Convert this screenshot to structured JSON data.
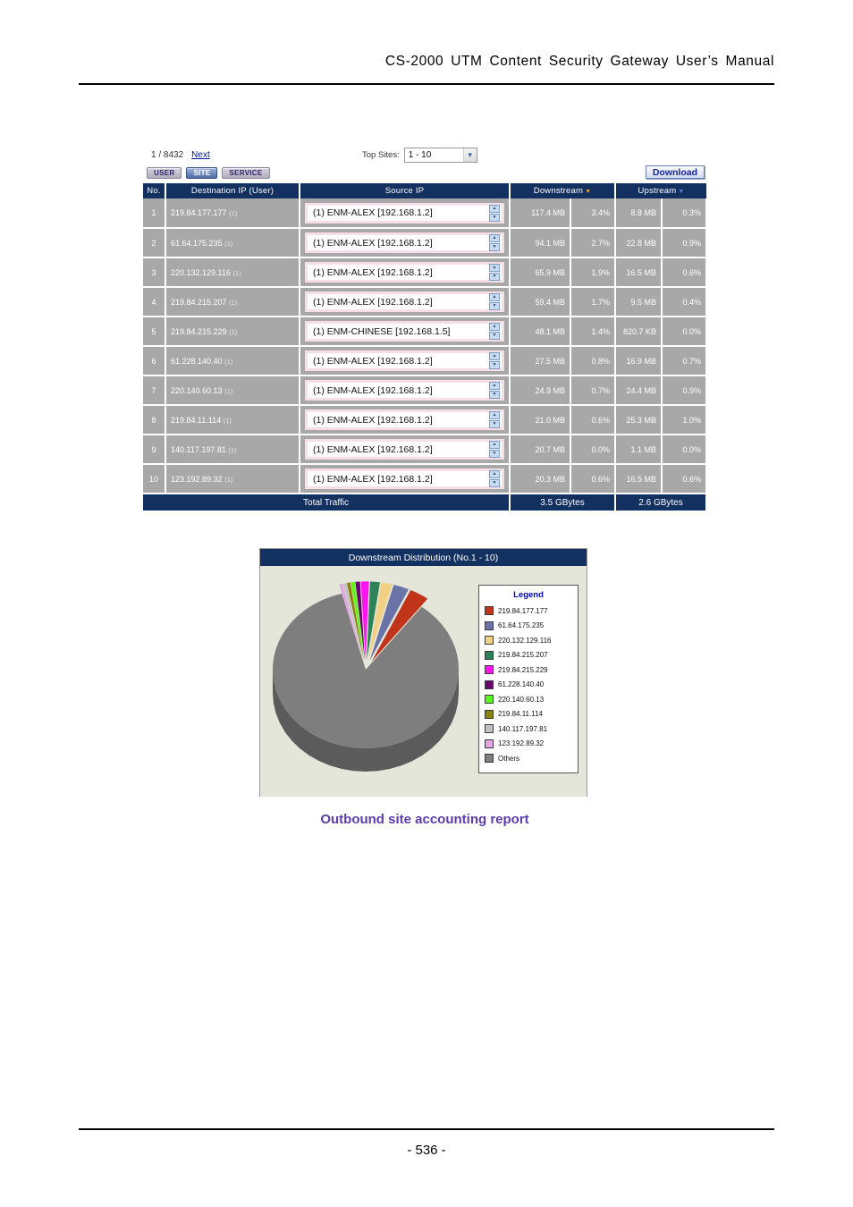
{
  "document": {
    "header_title": "CS-2000 UTM Content Security Gateway User’s Manual",
    "page_number": "- 536 -",
    "caption": "Outbound site accounting report"
  },
  "toolbar": {
    "pager_text": "1 / 8432",
    "next_label": "Next",
    "top_sites_label": "Top Sites:",
    "top_sites_value": "1 - 10",
    "top_sites_options": [
      "1 - 10"
    ],
    "dropdown_icon": "chevron-down-icon",
    "download_label": "Download",
    "tabs": [
      {
        "label": "USER",
        "active": false
      },
      {
        "label": "SITE",
        "active": true
      },
      {
        "label": "SERVICE",
        "active": false
      }
    ]
  },
  "table": {
    "columns": [
      "No.",
      "Destination IP (User)",
      "Source IP",
      "Downstream",
      "Upstream"
    ],
    "downstream_sort_icon": "sort-descending-icon",
    "upstream_sort_icon": "sort-descending-icon",
    "rows": [
      {
        "no": "1",
        "destination": "219.84.177.177",
        "dest_count": "(1)",
        "source": "(1) ENM-ALEX [192.168.1.2]",
        "down": "117.4 MB",
        "down_pct": "3.4%",
        "up": "8.8 MB",
        "up_pct": "0.3%"
      },
      {
        "no": "2",
        "destination": "61.64.175.235",
        "dest_count": "(1)",
        "source": "(1) ENM-ALEX [192.168.1.2]",
        "down": "94.1 MB",
        "down_pct": "2.7%",
        "up": "22.8 MB",
        "up_pct": "0.9%"
      },
      {
        "no": "3",
        "destination": "220.132.129.116",
        "dest_count": "(1)",
        "source": "(1) ENM-ALEX [192.168.1.2]",
        "down": "65.9 MB",
        "down_pct": "1.9%",
        "up": "16.5 MB",
        "up_pct": "0.6%"
      },
      {
        "no": "4",
        "destination": "219.84.215.207",
        "dest_count": "(1)",
        "source": "(1) ENM-ALEX [192.168.1.2]",
        "down": "59.4 MB",
        "down_pct": "1.7%",
        "up": "9.5 MB",
        "up_pct": "0.4%"
      },
      {
        "no": "5",
        "destination": "219.84.215.229",
        "dest_count": "(1)",
        "source": "(1) ENM-CHINESE [192.168.1.5]",
        "down": "48.1 MB",
        "down_pct": "1.4%",
        "up": "820.7 KB",
        "up_pct": "0.0%"
      },
      {
        "no": "6",
        "destination": "61.228.140.40",
        "dest_count": "(1)",
        "source": "(1) ENM-ALEX [192.168.1.2]",
        "down": "27.5 MB",
        "down_pct": "0.8%",
        "up": "16.9 MB",
        "up_pct": "0.7%"
      },
      {
        "no": "7",
        "destination": "220.140.60.13",
        "dest_count": "(1)",
        "source": "(1) ENM-ALEX [192.168.1.2]",
        "down": "24.9 MB",
        "down_pct": "0.7%",
        "up": "24.4 MB",
        "up_pct": "0.9%"
      },
      {
        "no": "8",
        "destination": "219.84.11.114",
        "dest_count": "(1)",
        "source": "(1) ENM-ALEX [192.168.1.2]",
        "down": "21.0 MB",
        "down_pct": "0.6%",
        "up": "25.3 MB",
        "up_pct": "1.0%"
      },
      {
        "no": "9",
        "destination": "140.117.197.81",
        "dest_count": "(1)",
        "source": "(1) ENM-ALEX [192.168.1.2]",
        "down": "20.7 MB",
        "down_pct": "0.0%",
        "up": "1.1 MB",
        "up_pct": "0.0%"
      },
      {
        "no": "10",
        "destination": "123.192.89.32",
        "dest_count": "(1)",
        "source": "(1) ENM-ALEX [192.168.1.2]",
        "down": "20.3 MB",
        "down_pct": "0.6%",
        "up": "16.5 MB",
        "up_pct": "0.6%"
      }
    ],
    "total": {
      "label": "Total Traffic",
      "downstream": "3.5 GBytes",
      "upstream": "2.6 GBytes"
    }
  },
  "chart_data": {
    "type": "pie",
    "title": "Downstream Distribution (No.1 - 10)",
    "legend_title": "Legend",
    "legend_position": "right",
    "exploded": true,
    "three_d": true,
    "categories": [
      "219.84.177.177",
      "61.64.175.235",
      "220.132.129.116",
      "219.84.215.207",
      "219.84.215.229",
      "61.228.140.40",
      "220.140.60.13",
      "219.84.11.114",
      "140.117.197.81",
      "123.192.89.32",
      "Others"
    ],
    "values": [
      3.4,
      2.7,
      1.9,
      1.7,
      1.4,
      0.8,
      0.7,
      0.6,
      0.6,
      0.6,
      85.6
    ],
    "colors": [
      "#c0341a",
      "#6a73a8",
      "#f2d184",
      "#2e8258",
      "#ff13f0",
      "#69066e",
      "#5ef81f",
      "#8b8209",
      "#c3c3c3",
      "#e2a6e0",
      "#7e7e7e"
    ],
    "unit": "percent"
  }
}
